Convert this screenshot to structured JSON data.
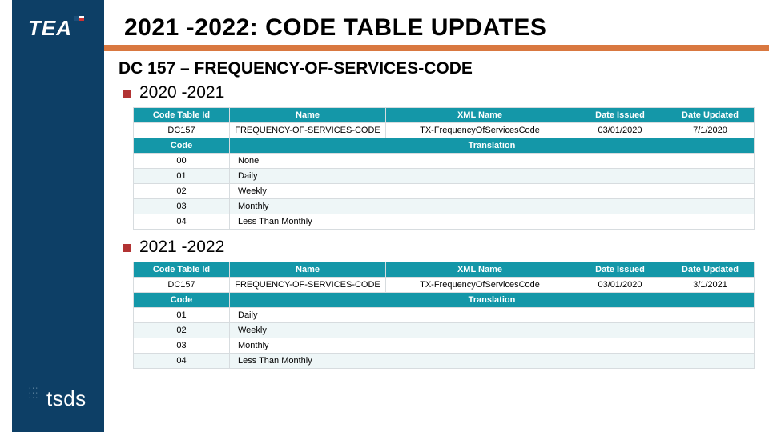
{
  "brand": {
    "tea": "TEA",
    "tsds": "tsds"
  },
  "title": "2021 -2022: CODE TABLE UPDATES",
  "subtitle": "DC 157 – FREQUENCY-OF-SERVICES-CODE",
  "sections": [
    {
      "label": "2020 -2021"
    },
    {
      "label": "2021 -2022"
    }
  ],
  "table_headers": {
    "ct": "Code Table Id",
    "name": "Name",
    "xml": "XML Name",
    "issued": "Date Issued",
    "updated": "Date Updated",
    "code": "Code",
    "translation": "Translation"
  },
  "table1": {
    "meta": {
      "id": "DC157",
      "name": "FREQUENCY-OF-SERVICES-CODE",
      "xml": "TX-FrequencyOfServicesCode",
      "issued": "03/01/2020",
      "updated": "7/1/2020"
    },
    "rows": [
      {
        "code": "00",
        "translation": "None"
      },
      {
        "code": "01",
        "translation": "Daily"
      },
      {
        "code": "02",
        "translation": "Weekly"
      },
      {
        "code": "03",
        "translation": "Monthly"
      },
      {
        "code": "04",
        "translation": "Less Than Monthly"
      }
    ]
  },
  "table2": {
    "meta": {
      "id": "DC157",
      "name": "FREQUENCY-OF-SERVICES-CODE",
      "xml": "TX-FrequencyOfServicesCode",
      "issued": "03/01/2020",
      "updated": "3/1/2021"
    },
    "rows": [
      {
        "code": "01",
        "translation": "Daily"
      },
      {
        "code": "02",
        "translation": "Weekly"
      },
      {
        "code": "03",
        "translation": "Monthly"
      },
      {
        "code": "04",
        "translation": "Less Than Monthly"
      }
    ]
  }
}
